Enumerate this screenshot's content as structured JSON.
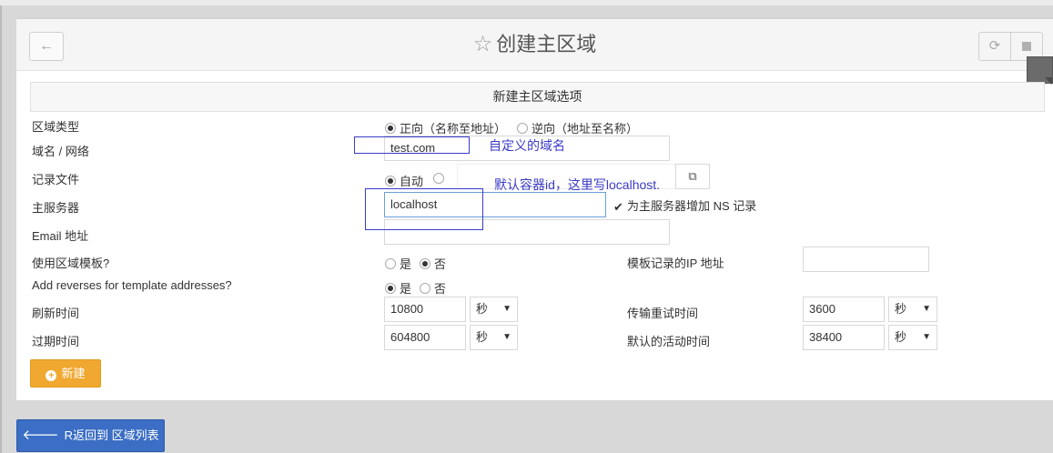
{
  "header": {
    "title": "创建主区域",
    "back_icon": "←",
    "refresh_icon": "⟳"
  },
  "section_title": "新建主区域选项",
  "form": {
    "zone_type": {
      "label": "区域类型",
      "options": [
        "正向（名称至地址）",
        "逆向（地址至名称）"
      ],
      "selected": 0
    },
    "domain": {
      "label": "域名 / 网络",
      "value": "test.com"
    },
    "record_file": {
      "label": "记录文件",
      "auto_label": "自动",
      "value": ""
    },
    "master_server": {
      "label": "主服务器",
      "value": "localhost",
      "add_ns_label": "为主服务器增加 NS 记录",
      "add_ns_checked": true
    },
    "email": {
      "label": "Email 地址",
      "value": ""
    },
    "use_template": {
      "label": "使用区域模板?",
      "yes": "是",
      "no": "否",
      "selected": "no",
      "ip_label": "模板记录的IP 地址",
      "ip_value": ""
    },
    "add_reverses": {
      "label": "Add reverses for template addresses?",
      "yes": "是",
      "no": "否",
      "selected": "yes"
    },
    "refresh": {
      "label": "刷新时间",
      "value": "10800",
      "unit": "秒"
    },
    "transfer_retry": {
      "label": "传输重试时间",
      "value": "3600",
      "unit": "秒"
    },
    "expiry": {
      "label": "过期时间",
      "value": "604800",
      "unit": "秒"
    },
    "default_ttl": {
      "label": "默认的活动时间",
      "value": "38400",
      "unit": "秒"
    }
  },
  "annotations": {
    "domain_note": "自定义的域名",
    "server_note": "默认容器id，这里写localhost."
  },
  "buttons": {
    "new": "新建",
    "return": "R返回到 区域列表"
  },
  "colors": {
    "new_button": "#f0a830",
    "return_button": "#3b6ec4",
    "annotation": "#3a3ac8"
  }
}
